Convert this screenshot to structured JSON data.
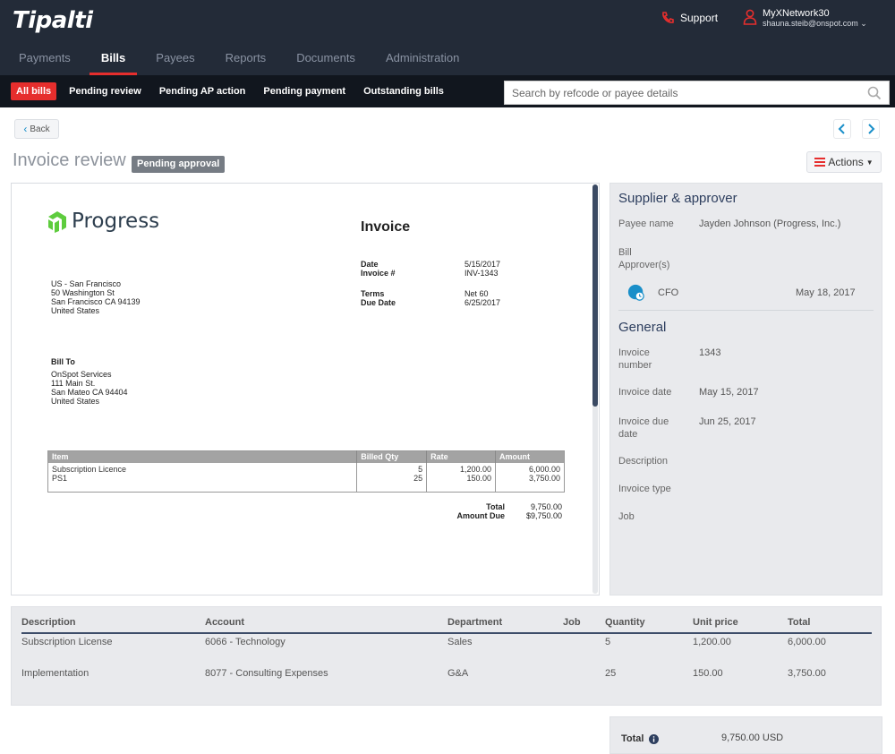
{
  "header": {
    "logo": "Tipalti",
    "support_label": "Support",
    "user_name": "MyXNetwork30",
    "user_email": "shauna.steib@onspot.com"
  },
  "main_nav": [
    "Payments",
    "Bills",
    "Payees",
    "Reports",
    "Documents",
    "Administration"
  ],
  "main_nav_active": "Bills",
  "sub_nav": [
    "All bills",
    "Pending review",
    "Pending AP action",
    "Pending payment",
    "Outstanding bills"
  ],
  "sub_nav_active": "All bills",
  "search": {
    "placeholder": "Search by refcode or payee details"
  },
  "toolbar": {
    "back_label": "Back",
    "actions_label": "Actions"
  },
  "page": {
    "title": "Invoice review",
    "status_badge": "Pending approval"
  },
  "document": {
    "company": "Progress",
    "heading": "Invoice",
    "meta": [
      {
        "k": "Date",
        "v": "5/15/2017"
      },
      {
        "k": "Invoice #",
        "v": "INV-1343"
      },
      {
        "k": "Terms",
        "v": "Net 60"
      },
      {
        "k": "Due Date",
        "v": "6/25/2017"
      }
    ],
    "from_address": [
      "US - San Francisco",
      "50 Washington St",
      "San Francisco CA 94139",
      "United States"
    ],
    "bill_to_label": "Bill To",
    "bill_to": [
      "OnSpot Services",
      "111 Main St.",
      "San Mateo CA 94404",
      "United States"
    ],
    "table_headers": [
      "Item",
      "Billed Qty",
      "Rate",
      "Amount"
    ],
    "items": [
      "Subscription Licence",
      "PS1"
    ],
    "qtys": [
      "5",
      "25"
    ],
    "rates": [
      "1,200.00",
      "150.00"
    ],
    "amounts": [
      "6,000.00",
      "3,750.00"
    ],
    "total_label": "Total",
    "total_value": "9,750.00",
    "amount_due_label": "Amount Due",
    "amount_due_value": "$9,750.00"
  },
  "side": {
    "supplier_heading": "Supplier & approver",
    "payee_label": "Payee name",
    "payee_value": "Jayden Johnson (Progress, Inc.)",
    "approver_label": "Bill Approver(s)",
    "approver_role": "CFO",
    "approver_date": "May 18, 2017",
    "general_heading": "General",
    "invoice_number_label": "Invoice number",
    "invoice_number_value": "1343",
    "invoice_date_label": "Invoice date",
    "invoice_date_value": "May 15, 2017",
    "invoice_due_label": "Invoice due date",
    "invoice_due_value": "Jun 25, 2017",
    "description_label": "Description",
    "invoice_type_label": "Invoice type",
    "job_label": "Job"
  },
  "lines": {
    "headers": [
      "Description",
      "Account",
      "Department",
      "Job",
      "Quantity",
      "Unit price",
      "Total"
    ],
    "rows": [
      [
        "Subscription License",
        "6066 - Technology",
        "Sales",
        "",
        "5",
        "1,200.00",
        "6,000.00"
      ],
      [
        "Implementation",
        "8077 - Consulting Expenses",
        "G&A",
        "",
        "25",
        "150.00",
        "3,750.00"
      ]
    ]
  },
  "total": {
    "label": "Total",
    "value": "9,750.00 USD"
  },
  "colors": {
    "topbar": "#232b38",
    "accent": "#e62e2d",
    "subbar": "#11161e",
    "heading": "#2d3e5e"
  }
}
